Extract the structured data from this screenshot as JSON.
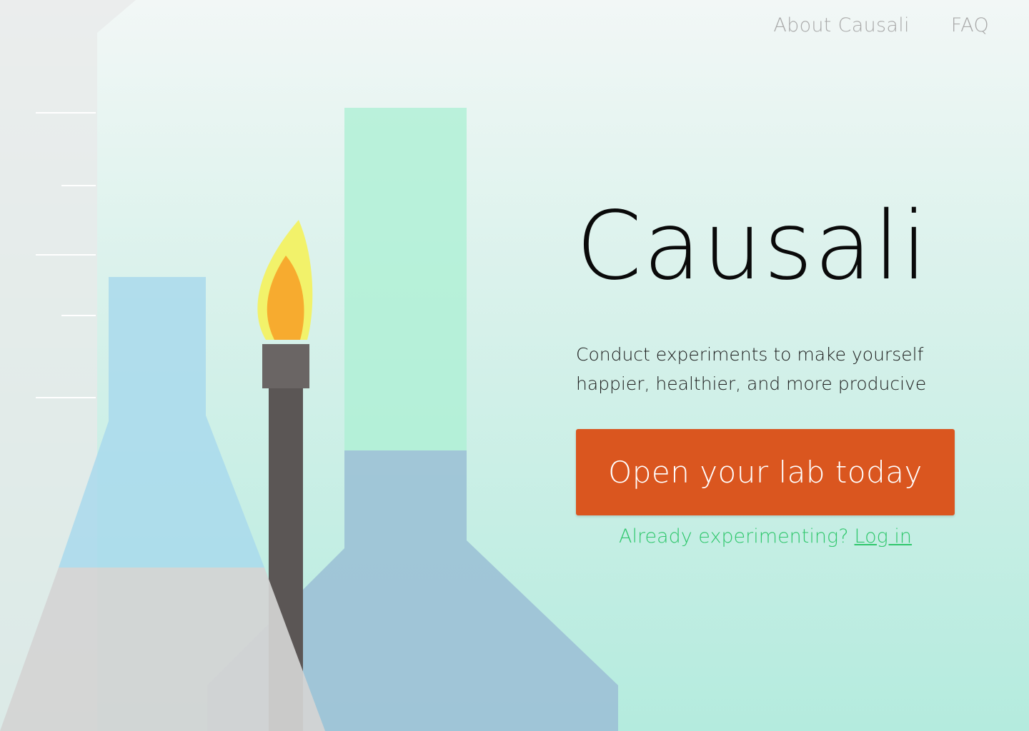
{
  "nav": {
    "about_label": "About Causali",
    "faq_label": "FAQ"
  },
  "hero": {
    "title": "Causali",
    "subtitle": "Conduct experiments to make yourself happier, healthier, and more producive",
    "cta_label": "Open your lab today",
    "login_prompt": "Already experimenting?",
    "login_link": "Log in"
  },
  "colors": {
    "cta_background": "#da561f",
    "login_green": "#2fc76c",
    "nav_text": "#a9a9a9"
  }
}
